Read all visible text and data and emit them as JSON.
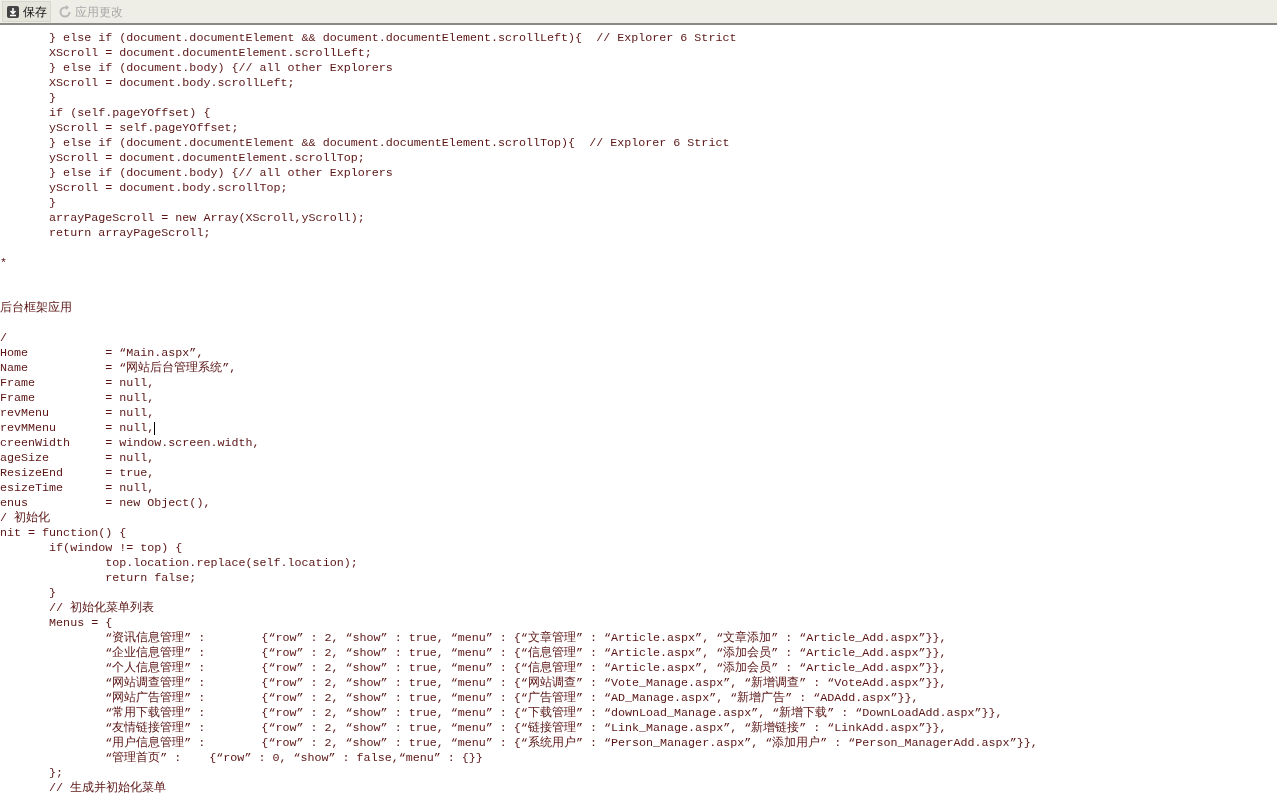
{
  "toolbar": {
    "buttons": [
      {
        "label": "保存",
        "kind": "save",
        "disabled": false
      },
      {
        "label": "应用更改",
        "kind": "apply",
        "disabled": true
      }
    ]
  },
  "editor": {
    "lines": [
      {
        "kind": "code",
        "text": "       } else if (document.documentElement && document.documentElement.scrollLeft){  // Explorer 6 Strict"
      },
      {
        "kind": "code",
        "text": "       XScroll = document.documentElement.scrollLeft;"
      },
      {
        "kind": "code",
        "text": "       } else if (document.body) {// all other Explorers"
      },
      {
        "kind": "code",
        "text": "       XScroll = document.body.scrollLeft;"
      },
      {
        "kind": "code",
        "text": "       }"
      },
      {
        "kind": "code",
        "text": "       if (self.pageYOffset) {"
      },
      {
        "kind": "code",
        "text": "       yScroll = self.pageYOffset;"
      },
      {
        "kind": "code",
        "text": "       } else if (document.documentElement && document.documentElement.scrollTop){  // Explorer 6 Strict"
      },
      {
        "kind": "code",
        "text": "       yScroll = document.documentElement.scrollTop;"
      },
      {
        "kind": "code",
        "text": "       } else if (document.body) {// all other Explorers"
      },
      {
        "kind": "code",
        "text": "       yScroll = document.body.scrollTop;"
      },
      {
        "kind": "code",
        "text": "       }"
      },
      {
        "kind": "code",
        "text": "       arrayPageScroll = new Array(XScroll,yScroll);"
      },
      {
        "kind": "code",
        "text": "       return arrayPageScroll;"
      },
      {
        "kind": "blank"
      },
      {
        "kind": "code",
        "text": "*"
      },
      {
        "kind": "blank"
      },
      {
        "kind": "blank"
      },
      {
        "kind": "code",
        "text": "后台框架应用"
      },
      {
        "kind": "blank"
      },
      {
        "kind": "code",
        "text": "/"
      },
      {
        "kind": "code",
        "text": "Home           = “Main.aspx”,"
      },
      {
        "kind": "code",
        "text": "Name           = “网站后台管理系统”,"
      },
      {
        "kind": "code",
        "text": "Frame          = null,"
      },
      {
        "kind": "code",
        "text": "Frame          = null,"
      },
      {
        "kind": "code",
        "text": "revMenu        = null,"
      },
      {
        "kind": "code",
        "text": "revMMenu       = null,",
        "cursor": true
      },
      {
        "kind": "code",
        "text": "creenWidth     = window.screen.width,"
      },
      {
        "kind": "code",
        "text": "ageSize        = null,"
      },
      {
        "kind": "code",
        "text": "ResizeEnd      = true,"
      },
      {
        "kind": "code",
        "text": "esizeTime      = null,"
      },
      {
        "kind": "code",
        "text": "enus           = new Object(),"
      },
      {
        "kind": "code",
        "text": "/ 初始化"
      },
      {
        "kind": "code",
        "text": "nit = function() {"
      },
      {
        "kind": "code",
        "text": "       if(window != top) {"
      },
      {
        "kind": "code",
        "text": "               top.location.replace(self.location);"
      },
      {
        "kind": "code",
        "text": "               return false;"
      },
      {
        "kind": "code",
        "text": "       }"
      },
      {
        "kind": "code",
        "text": "       // 初始化菜单列表"
      },
      {
        "kind": "code",
        "text": "       Menus = {"
      },
      {
        "kind": "code",
        "text": "               “资讯信息管理” :        {“row” : 2, “show” : true, “menu” : {“文章管理” : “Article.aspx”, “文章添加” : “Article_Add.aspx”}},"
      },
      {
        "kind": "code",
        "text": "               “企业信息管理” :        {“row” : 2, “show” : true, “menu” : {“信息管理” : “Article.aspx”, “添加会员” : “Article_Add.aspx”}},"
      },
      {
        "kind": "code",
        "text": "               “个人信息管理” :        {“row” : 2, “show” : true, “menu” : {“信息管理” : “Article.aspx”, “添加会员” : “Article_Add.aspx”}},"
      },
      {
        "kind": "code",
        "text": "               “网站调查管理” :        {“row” : 2, “show” : true, “menu” : {“网站调查” : “Vote_Manage.aspx”, “新增调查” : “VoteAdd.aspx”}},"
      },
      {
        "kind": "code",
        "text": "               “网站广告管理” :        {“row” : 2, “show” : true, “menu” : {“广告管理” : “AD_Manage.aspx”, “新增广告” : “ADAdd.aspx”}},"
      },
      {
        "kind": "code",
        "text": "               “常用下载管理” :        {“row” : 2, “show” : true, “menu” : {“下载管理” : “downLoad_Manage.aspx”, “新增下载” : “DownLoadAdd.aspx”}},"
      },
      {
        "kind": "code",
        "text": "               “友情链接管理” :        {“row” : 2, “show” : true, “menu” : {“链接管理” : “Link_Manage.aspx”, “新增链接” : “LinkAdd.aspx”}},"
      },
      {
        "kind": "code",
        "text": "               “用户信息管理” :        {“row” : 2, “show” : true, “menu” : {“系统用户” : “Person_Manager.aspx”, “添加用户” : “Person_ManagerAdd.aspx”}},"
      },
      {
        "kind": "code",
        "text": "               “管理首页” :    {“row” : 0, “show” : false,“menu” : {}}"
      },
      {
        "kind": "code",
        "text": "       };"
      },
      {
        "kind": "code",
        "text": "       // 生成并初始化菜单"
      }
    ]
  }
}
